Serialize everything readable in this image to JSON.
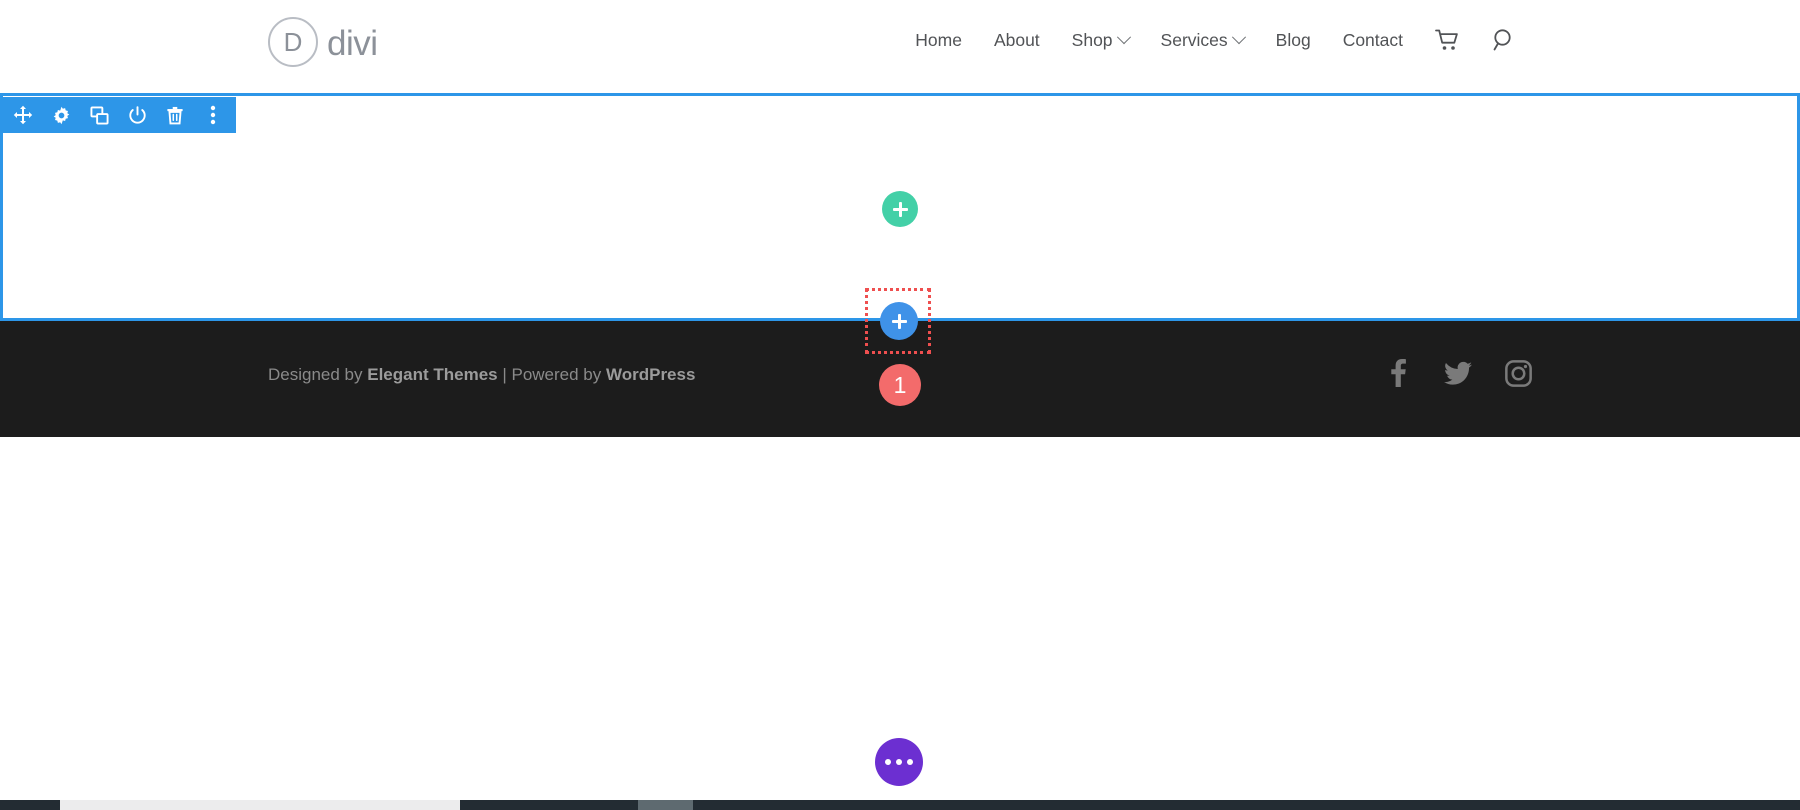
{
  "header": {
    "logo": {
      "mark": "D",
      "text": "divi",
      "name": "divi-logo"
    },
    "nav_items": [
      {
        "label": "Home",
        "has_dropdown": false
      },
      {
        "label": "About",
        "has_dropdown": false
      },
      {
        "label": "Shop",
        "has_dropdown": true
      },
      {
        "label": "Services",
        "has_dropdown": true
      },
      {
        "label": "Blog",
        "has_dropdown": false
      },
      {
        "label": "Contact",
        "has_dropdown": false
      }
    ],
    "icons": [
      {
        "name": "cart-icon",
        "label": "Cart"
      },
      {
        "name": "search-icon",
        "label": "Search"
      }
    ]
  },
  "builder": {
    "section_border_color": "#2d96e8",
    "toolbar": {
      "background": "#2d96e8",
      "buttons": [
        {
          "name": "move-icon",
          "label": "Move Section"
        },
        {
          "name": "gear-icon",
          "label": "Section Settings"
        },
        {
          "name": "duplicate-icon",
          "label": "Duplicate Section"
        },
        {
          "name": "power-icon",
          "label": "Disable Section"
        },
        {
          "name": "trash-icon",
          "label": "Delete Section"
        },
        {
          "name": "more-vertical-icon",
          "label": "More Options"
        }
      ]
    },
    "add_row_button": {
      "name": "add-row-button",
      "glyph": "+",
      "color": "#43d0a7"
    },
    "add_module_button": {
      "name": "add-module-button",
      "glyph": "+",
      "color": "#3f92e8"
    },
    "drop_target": {
      "name": "drop-target-outline",
      "border_color": "#ef4f4f"
    },
    "count_badge": {
      "name": "count-badge",
      "value": "1",
      "color": "#f36b6b"
    },
    "fab": {
      "name": "builder-menu-fab",
      "color": "#6c2fd1",
      "label": "Builder Menu"
    }
  },
  "footer": {
    "credit_prefix": "Designed by ",
    "credit_brand": "Elegant Themes",
    "credit_separator": " | ",
    "credit_powered": "Powered by ",
    "credit_platform": "WordPress",
    "background": "#1c1c1c",
    "social": [
      {
        "name": "facebook-icon",
        "label": "Facebook"
      },
      {
        "name": "twitter-icon",
        "label": "Twitter"
      },
      {
        "name": "instagram-icon",
        "label": "Instagram"
      }
    ]
  }
}
